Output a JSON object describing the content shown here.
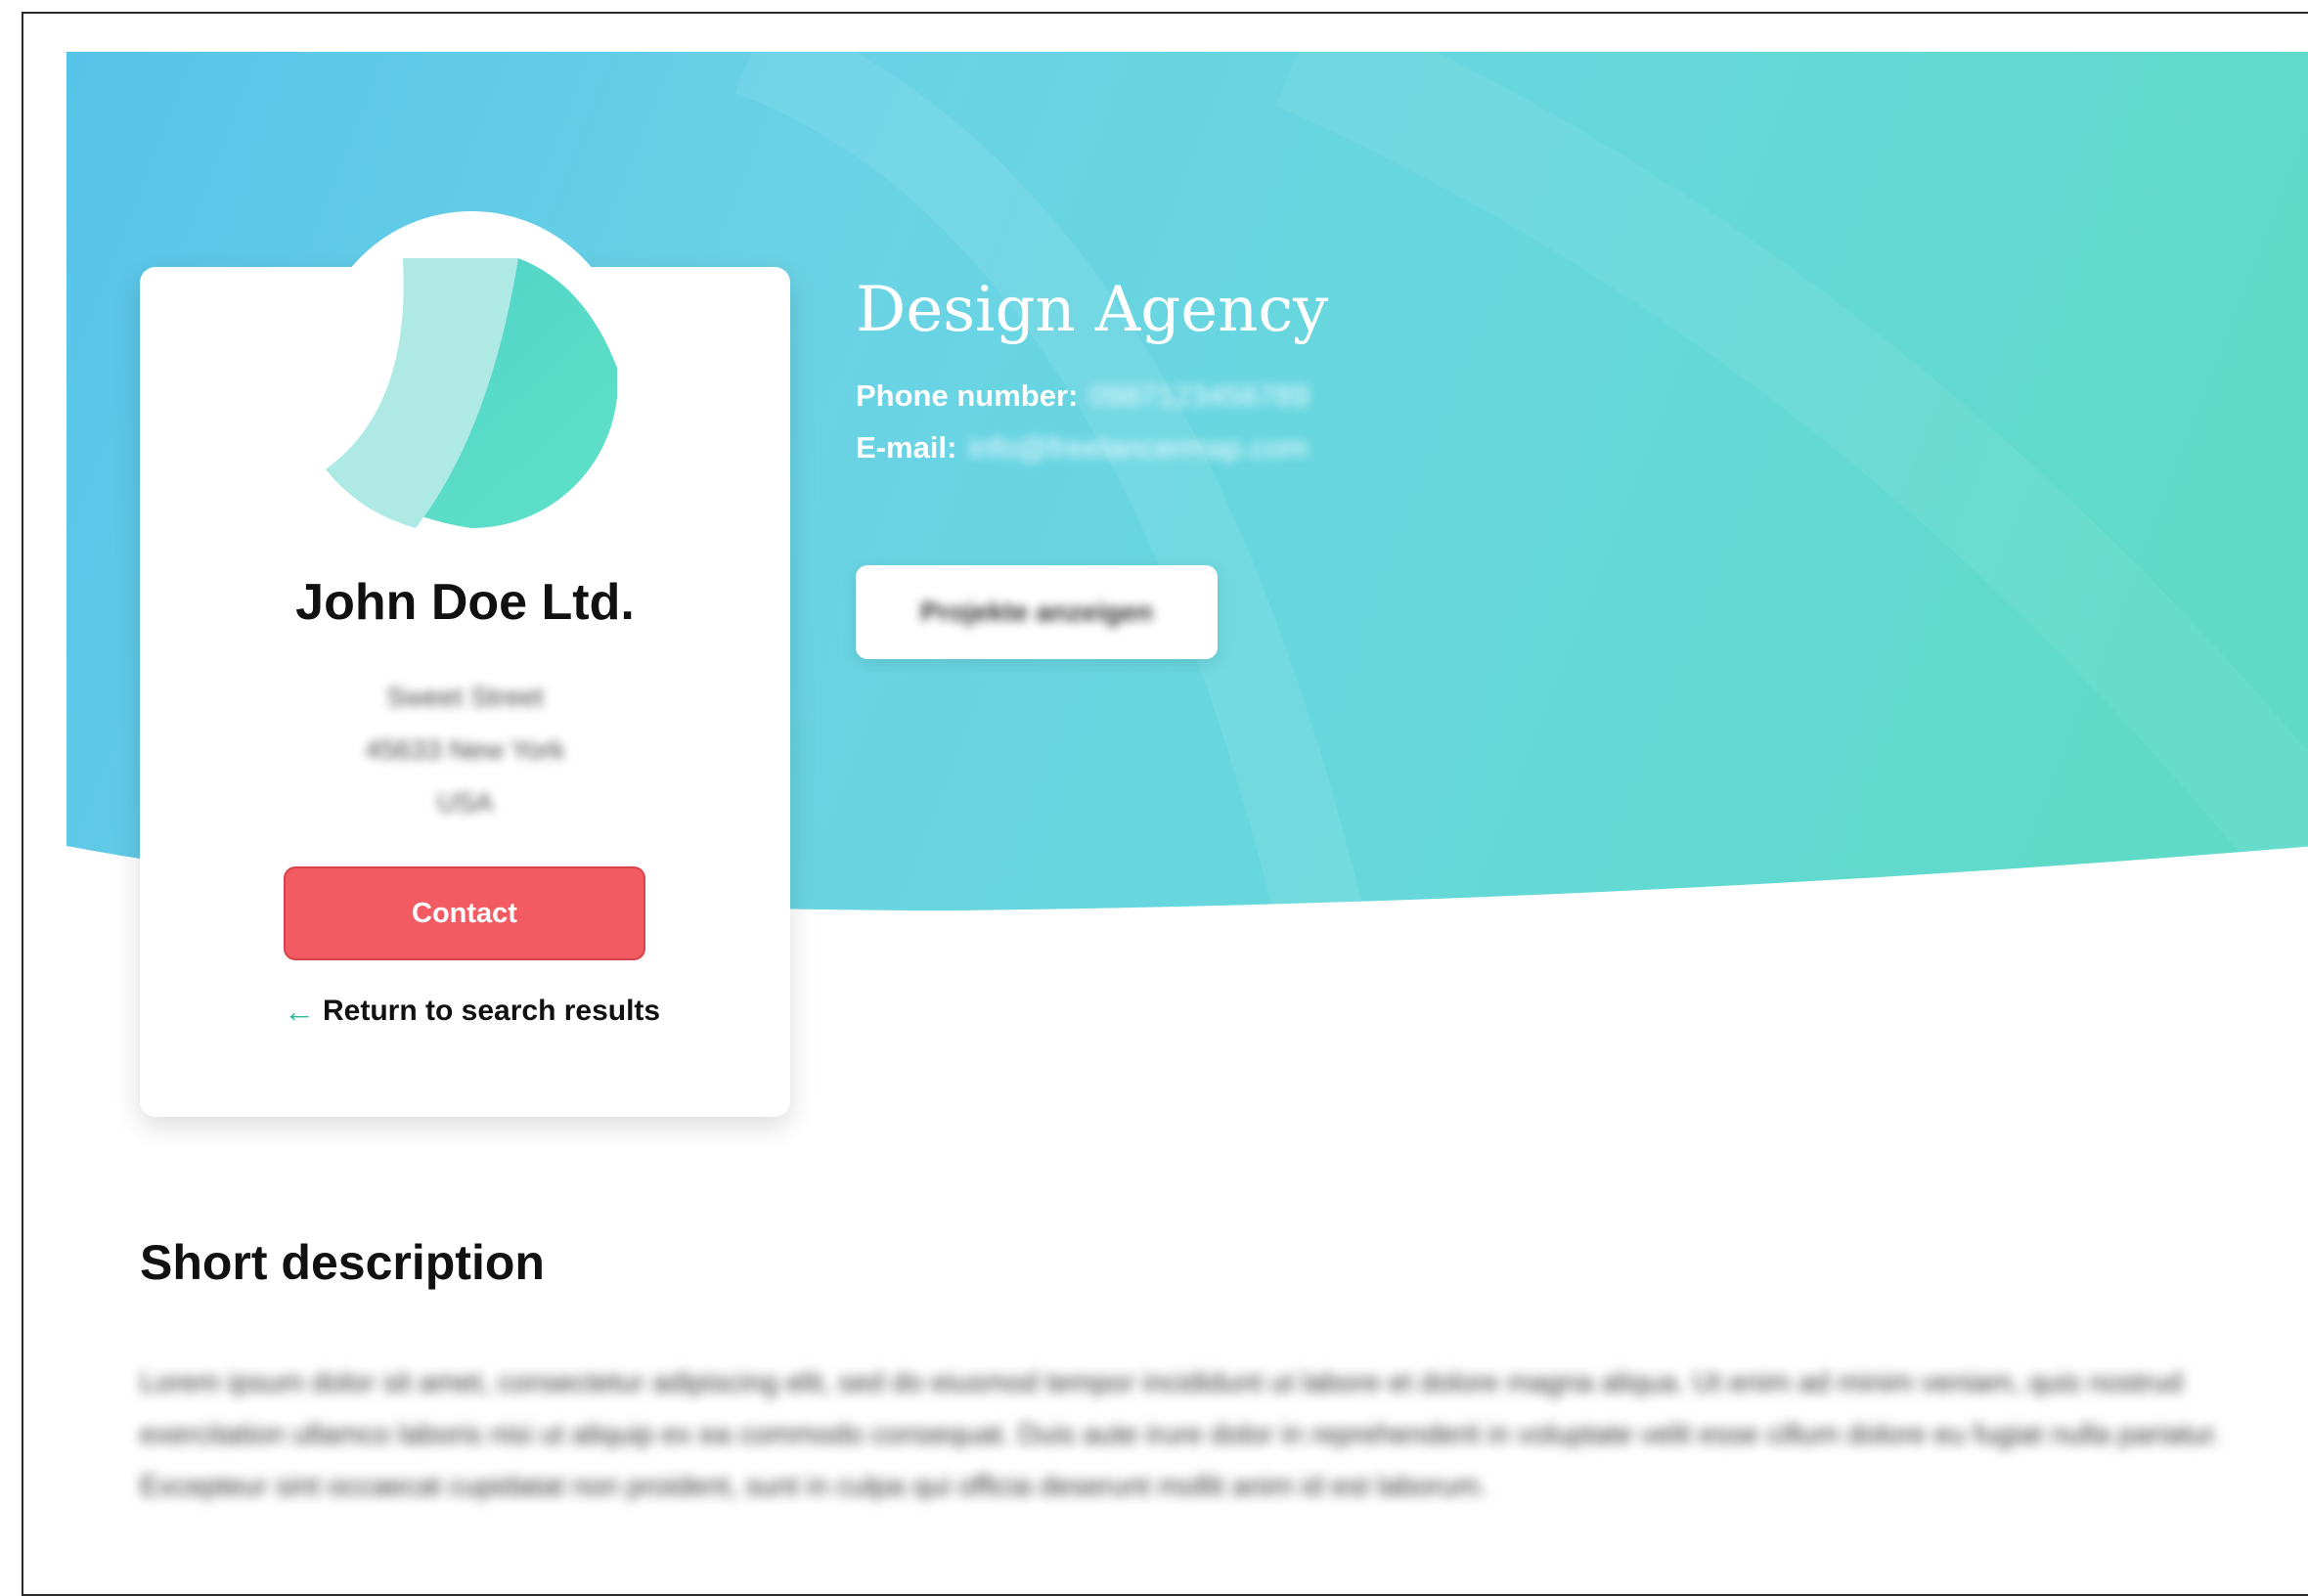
{
  "profile": {
    "company_name": "John Doe Ltd.",
    "address_lines": [
      "Sweet Street",
      "45633 New York",
      "USA"
    ],
    "contact_label": "Contact",
    "return_label": "Return to search results"
  },
  "hero": {
    "title": "Design Agency",
    "phone_label": "Phone number:",
    "phone_value": "0987123456789",
    "email_label": "E-mail:",
    "email_value": "info@freelancermap.com",
    "projects_button_label": "Projekte anzeigen"
  },
  "description": {
    "title": "Short description",
    "text": "Lorem ipsum dolor sit amet, consectetur adipiscing elit, sed do eiusmod tempor incididunt ut labore et dolore magna aliqua. Ut enim ad minim veniam, quis nostrud exercitation ullamco laboris nisi ut aliquip ex ea commodo consequat. Duis aute irure dolor in reprehenderit in voluptate velit esse cillum dolore eu fugiat nulla pariatur. Excepteur sint occaecat cupidatat non proident, sunt in culpa qui officia deserunt mollit anim id est laborum."
  },
  "icons": {
    "return_arrow": "arrow-left-icon",
    "logo": "leaf-logo-icon"
  },
  "colors": {
    "hero_start": "#56c4e8",
    "hero_end": "#63dad2",
    "contact_button": "#f35b62",
    "accent_arrow": "#2fb89f"
  }
}
